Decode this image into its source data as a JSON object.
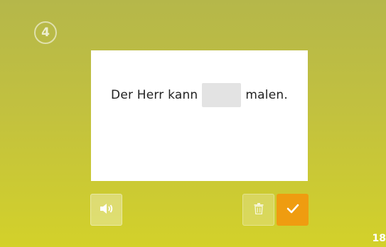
{
  "step": {
    "number": "4"
  },
  "exercise": {
    "before_gap": "Der Herr kann",
    "after_gap": "malen.",
    "gap_value": ""
  },
  "controls": {
    "audio_icon": "speaker-icon",
    "delete_icon": "trash-icon",
    "check_icon": "checkmark-icon",
    "check_color": "#ef9c10"
  },
  "page": {
    "number": "18"
  }
}
